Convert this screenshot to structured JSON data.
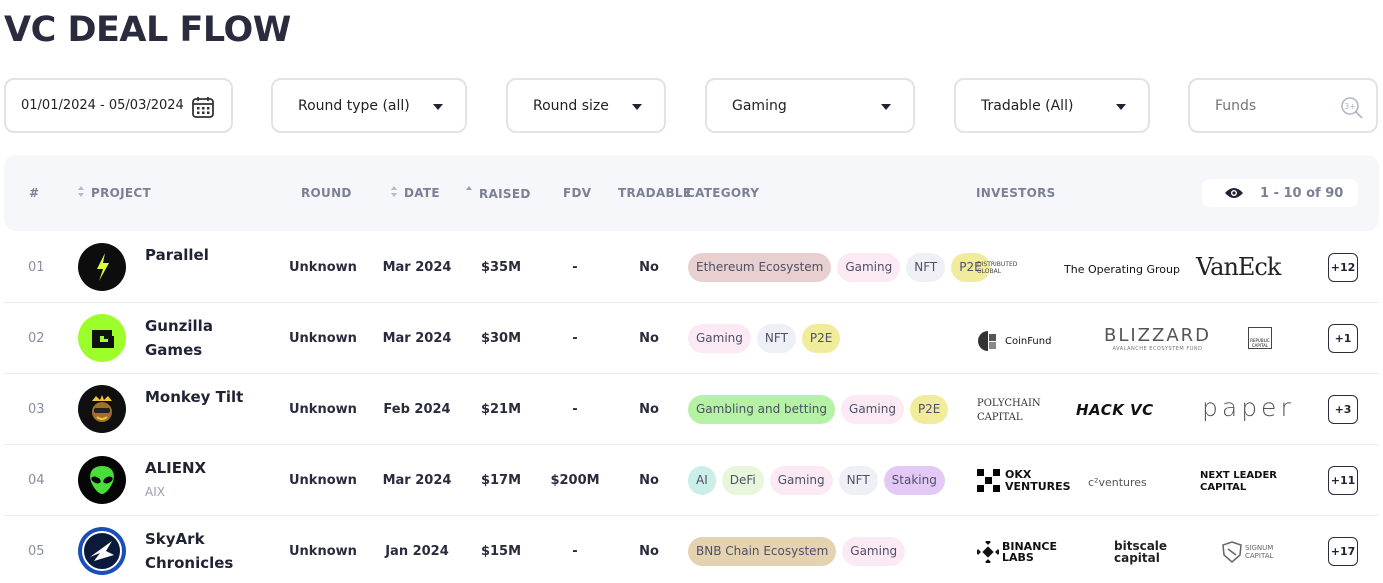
{
  "page": {
    "title": "VC DEAL FLOW"
  },
  "filters": {
    "date_range": "01/01/2024 - 05/03/2024",
    "round_type": "Round type (all)",
    "round_size": "Round size",
    "category": "Gaming",
    "tradable": "Tradable (All)",
    "funds_placeholder": "Funds"
  },
  "table": {
    "headers": {
      "index": "#",
      "project": "PROJECT",
      "round": "ROUND",
      "date": "DATE",
      "raised": "RAISED",
      "fdv": "FDV",
      "tradable": "TRADABLE",
      "category": "CATEGORY",
      "investors": "INVESTORS"
    },
    "pagination": "1 - 10 of 90",
    "rows": [
      {
        "index": "01",
        "project": "Parallel",
        "ticker": "",
        "round": "Unknown",
        "date": "Mar 2024",
        "raised": "$35M",
        "fdv": "-",
        "tradable": "No",
        "tags": [
          "Ethereum Ecosystem",
          "Gaming",
          "NFT",
          "P2E"
        ],
        "investors": [
          "DISTRIBUTED GLOBAL",
          "The Operating Group",
          "VanEck"
        ],
        "more": "+12"
      },
      {
        "index": "02",
        "project": "Gunzilla Games",
        "ticker": "",
        "round": "Unknown",
        "date": "Mar 2024",
        "raised": "$30M",
        "fdv": "-",
        "tradable": "No",
        "tags": [
          "Gaming",
          "NFT",
          "P2E"
        ],
        "investors": [
          "CoinFund",
          "BLIZZARD",
          "REPUBLIC CAPITAL"
        ],
        "investor_sub": "AVALANCHE ECOSYSTEM FUND",
        "more": "+1"
      },
      {
        "index": "03",
        "project": "Monkey Tilt",
        "ticker": "",
        "round": "Unknown",
        "date": "Feb 2024",
        "raised": "$21M",
        "fdv": "-",
        "tradable": "No",
        "tags": [
          "Gambling and betting",
          "Gaming",
          "P2E"
        ],
        "investors": [
          "POLYCHAIN CAPITAL",
          "HACK VC",
          "paper"
        ],
        "more": "+3"
      },
      {
        "index": "04",
        "project": "ALIENX",
        "ticker": "AIX",
        "round": "Unknown",
        "date": "Mar 2024",
        "raised": "$17M",
        "fdv": "$200M",
        "tradable": "No",
        "tags": [
          "AI",
          "DeFi",
          "Gaming",
          "NFT",
          "Staking"
        ],
        "investors": [
          "OKX VENTURES",
          "c²ventures",
          "NEXT LEADER CAPITAL"
        ],
        "more": "+11"
      },
      {
        "index": "05",
        "project": "SkyArk Chronicles",
        "ticker": "",
        "round": "Unknown",
        "date": "Jan 2024",
        "raised": "$15M",
        "fdv": "-",
        "tradable": "No",
        "tags": [
          "BNB Chain Ecosystem",
          "Gaming"
        ],
        "investors": [
          "BINANCE LABS",
          "bitscale capital",
          "SIGNUM CAPITAL"
        ],
        "more": "+17"
      }
    ]
  },
  "colors": {
    "tag_ethereum": "#e8cfd0",
    "tag_gaming": "#fbe9f4",
    "tag_nft": "#eef0f6",
    "tag_p2e": "#f1ec9c",
    "tag_gambling": "#b5f2a6",
    "tag_ai": "#cbeee8",
    "tag_defi": "#e6f7dc",
    "tag_staking": "#e4c9f7",
    "tag_bnb": "#e4d2b1"
  }
}
